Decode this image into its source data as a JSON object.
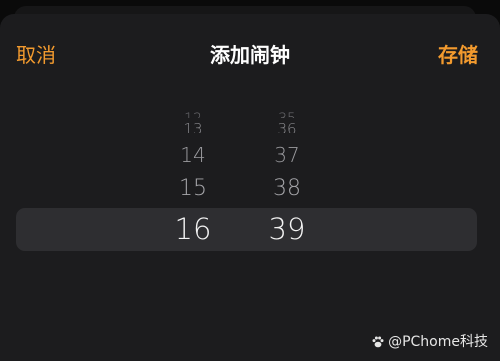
{
  "nav": {
    "cancel_label": "取消",
    "title": "添加闹钟",
    "save_label": "存储"
  },
  "picker": {
    "hours": [
      "13",
      "14",
      "15",
      "16"
    ],
    "minutes": [
      "36",
      "37",
      "38",
      "39"
    ],
    "above_hours": "12",
    "above_minutes": "35",
    "selected_hour": "16",
    "selected_minute": "39"
  },
  "watermark": {
    "text": "@PChome科技",
    "icon": "paw-icon"
  },
  "colors": {
    "accent": "#f29a2e",
    "sheet_background": "#1c1c1e",
    "selection_band": "#2e2e31"
  }
}
